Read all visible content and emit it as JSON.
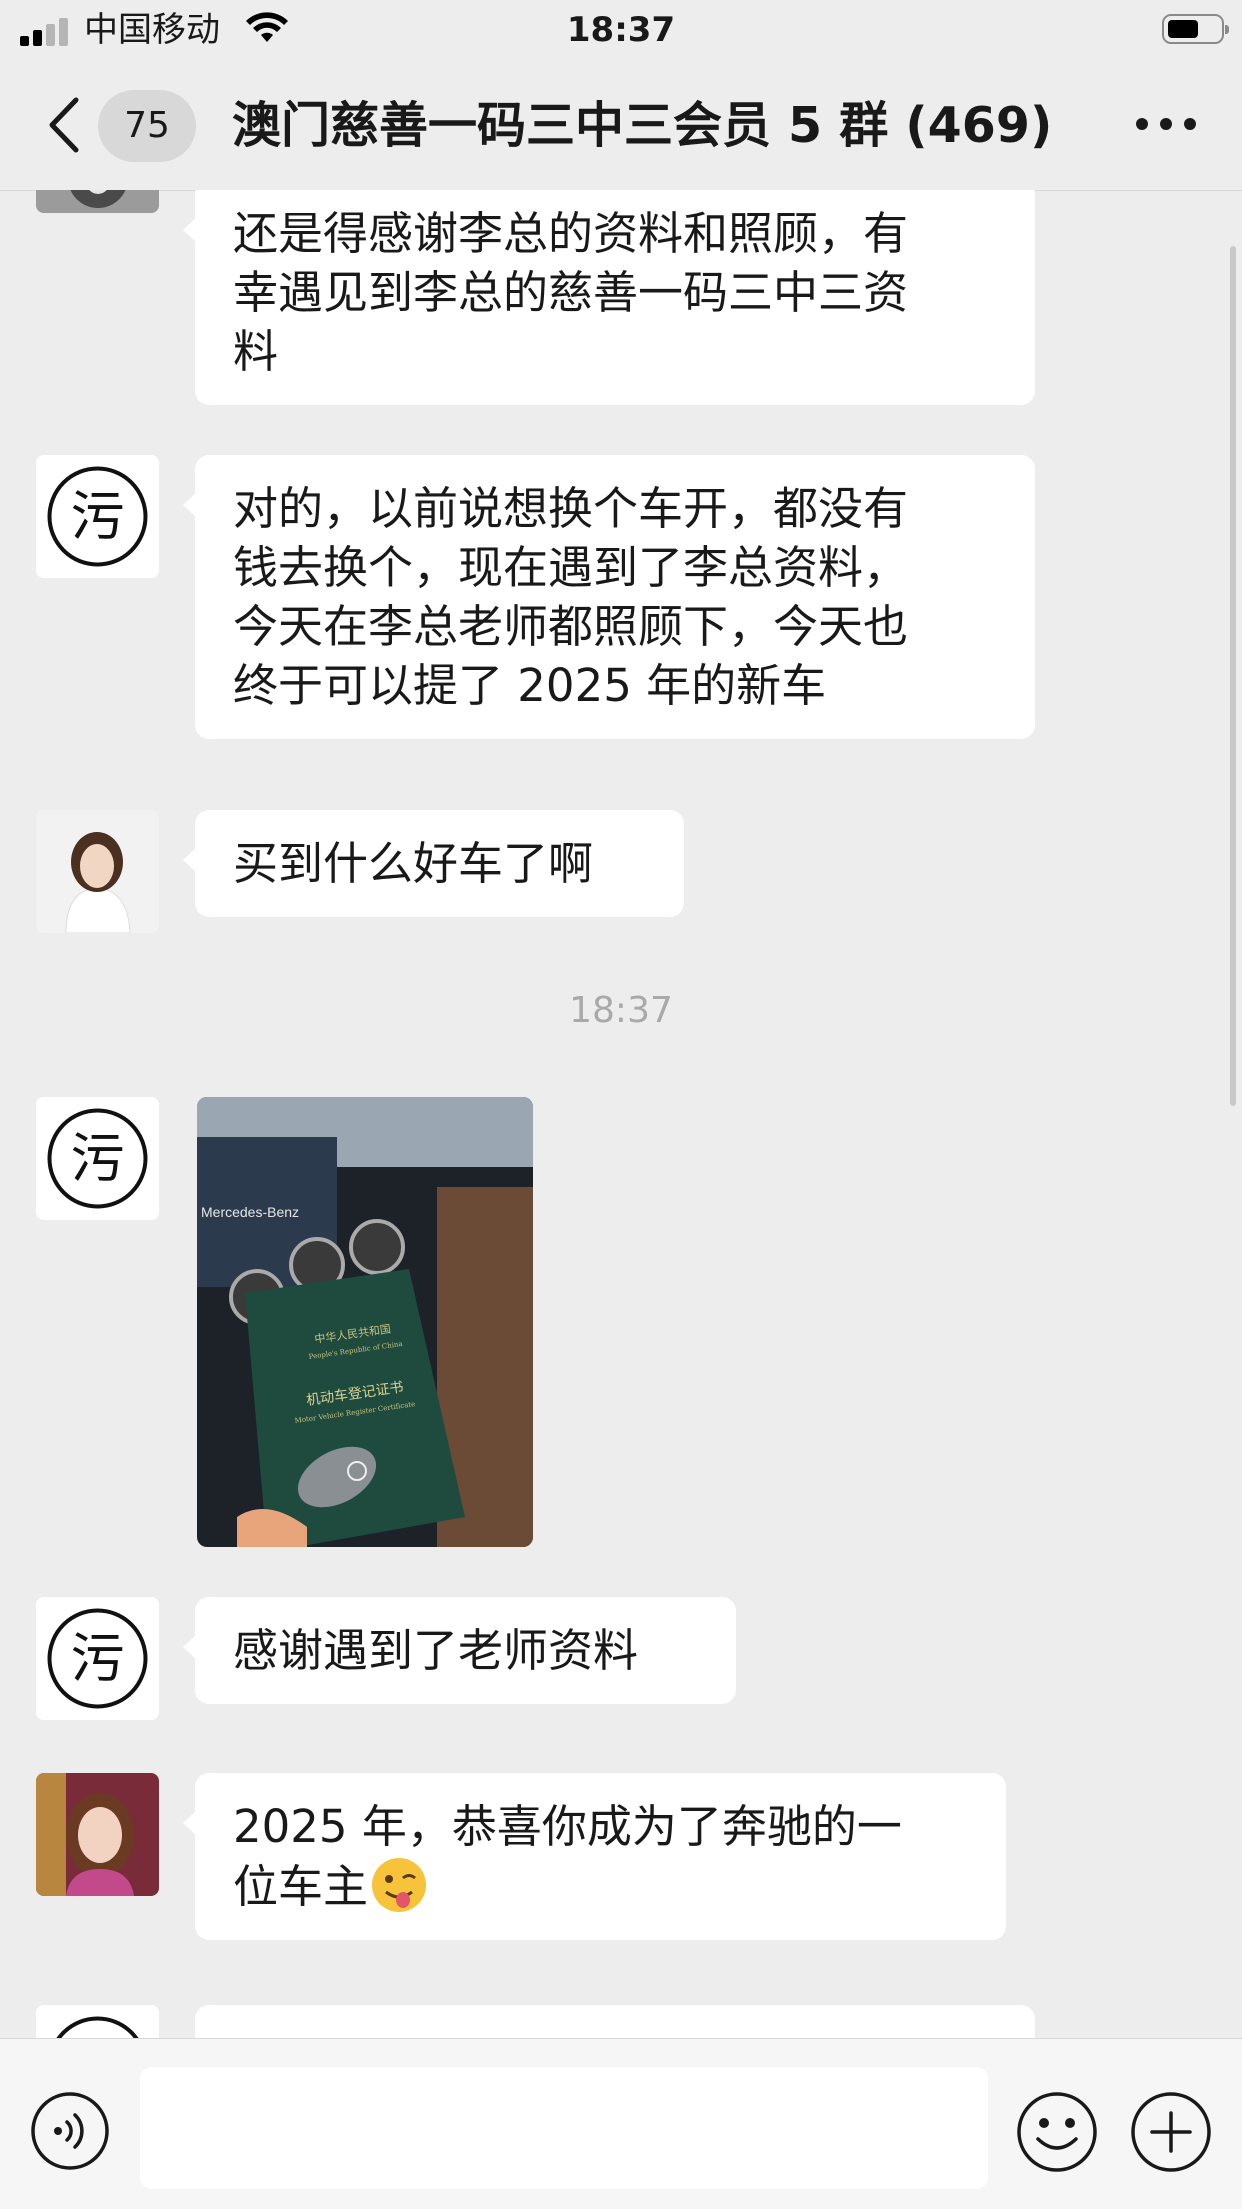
{
  "status_bar": {
    "carrier": "中国移动",
    "time": "18:37"
  },
  "nav": {
    "unread_count": "75",
    "title": "澳门慈善一码三中三会员 5 群 (469)"
  },
  "avatar_glyph": "污",
  "messages": [
    {
      "sender_avatar": "cat-photo",
      "text": "还是得感谢李总的资料和照顾，有\n幸遇见到李总的慈善一码三中三资\n料"
    },
    {
      "sender_avatar": "glyph",
      "text": "对的，以前说想换个车开，都没有\n钱去换个，现在遇到了李总资料，\n今天在李总老师都照顾下，今天也\n终于可以提了 2025 年的新车"
    },
    {
      "sender_avatar": "woman-white-shirt",
      "text": "买到什么好车了啊"
    },
    {
      "sender_avatar": "glyph",
      "type": "image",
      "image_text": {
        "brand": "Mercedes-Benz",
        "cover_line1": "中华人民共和国",
        "cover_line2": "People's Republic of China",
        "cover_line3": "机动车登记证书",
        "cover_line4": "Motor Vehicle Register Certificate"
      }
    },
    {
      "sender_avatar": "glyph",
      "text": "感谢遇到了老师资料"
    },
    {
      "sender_avatar": "woman-portrait",
      "text": "2025 年，恭喜你成为了奔驰的一\n位车主",
      "emoji": "winking-tongue-face"
    }
  ],
  "time_divider": "18:37",
  "icons": {
    "back": "chevron-left-icon",
    "more": "ellipsis-icon",
    "voice": "voice-icon",
    "emoji": "smile-icon",
    "plus": "plus-icon"
  },
  "colors": {
    "background": "#ededed",
    "bubble": "#ffffff",
    "time_text": "#a9a9a9"
  }
}
